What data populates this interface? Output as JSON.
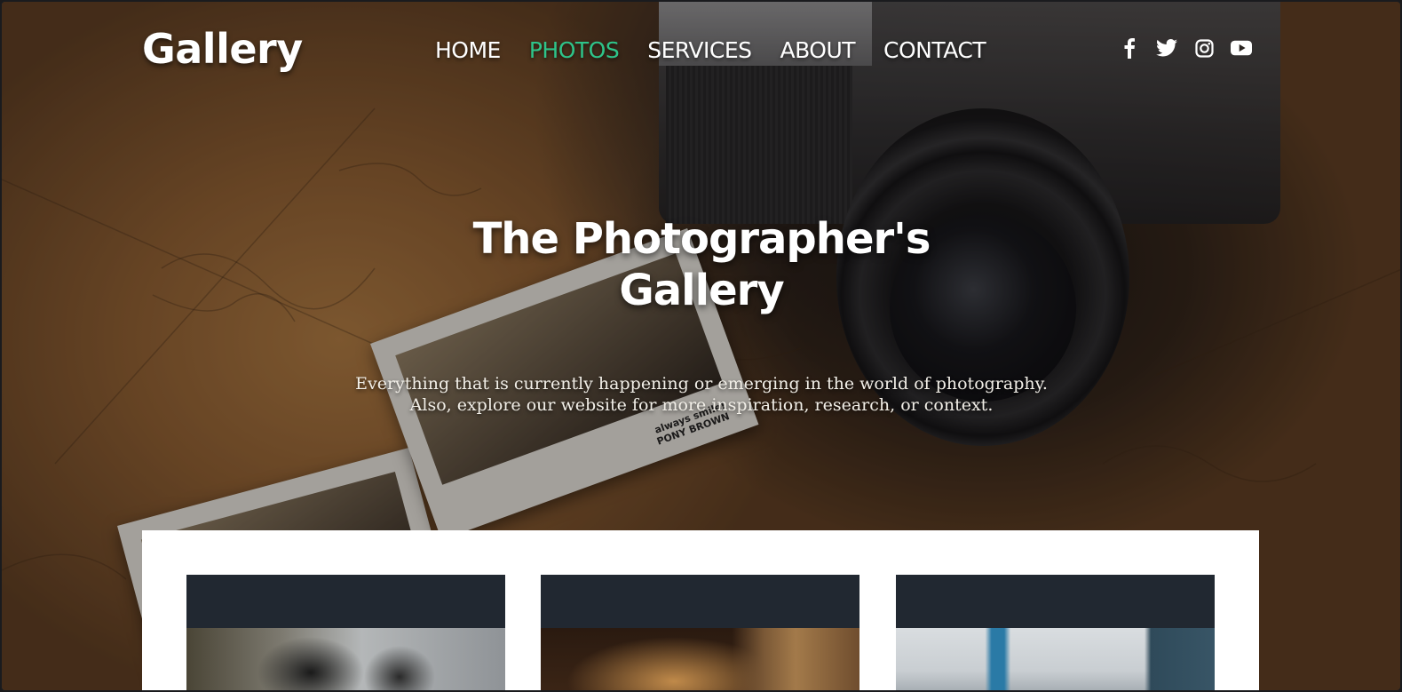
{
  "brand": {
    "title": "Gallery"
  },
  "nav": {
    "items": [
      {
        "label": "HOME",
        "active": false
      },
      {
        "label": "PHOTOS",
        "active": true
      },
      {
        "label": "SERVICES",
        "active": false
      },
      {
        "label": "ABOUT",
        "active": false
      },
      {
        "label": "CONTACT",
        "active": false
      }
    ]
  },
  "social": {
    "icons": [
      "facebook-icon",
      "twitter-icon",
      "instagram-icon",
      "youtube-icon"
    ]
  },
  "hero": {
    "title_line1": "The Photographer's",
    "title_line2": "Gallery",
    "subtitle_line1": "Everything that is currently happening or emerging in the world of photography.",
    "subtitle_line2": "Also, explore our website for more inspiration, research, or context."
  },
  "polaroid": {
    "caption_line1": "always smile!",
    "caption_line2": "PONY BROWN"
  },
  "gallery": {
    "cards": [
      {
        "image": "puffin-photo"
      },
      {
        "image": "cafe-interior-photo"
      },
      {
        "image": "city-skyline-photo"
      }
    ]
  },
  "colors": {
    "accent": "#2ec48a",
    "card_header": "#212831",
    "panel": "#ffffff"
  }
}
